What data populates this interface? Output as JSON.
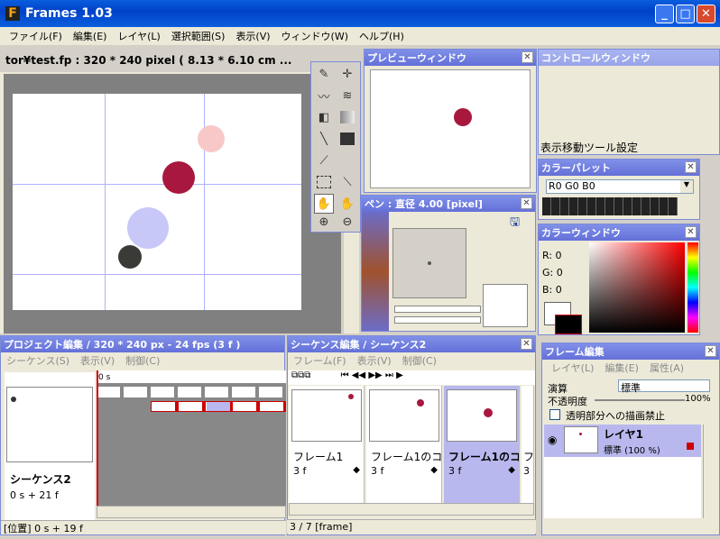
{
  "app": {
    "title": "Frames 1.03",
    "logo_letter": "F"
  },
  "window_buttons": {
    "min": "_",
    "max": "□",
    "close": "✕"
  },
  "menu": [
    "ファイル(F)",
    "編集(E)",
    "レイヤ(L)",
    "選択範囲(S)",
    "表示(V)",
    "ウィンドウ(W)",
    "ヘルプ(H)"
  ],
  "canvas": {
    "title": "tor¥test.fp : 320 * 240 pixel ( 8.13 * 6.10 cm ...",
    "bg_color": "#808080"
  },
  "preview": {
    "title": "プレビューウィンドウ",
    "close": "✕"
  },
  "control": {
    "title": "コントロールウィンドウ",
    "status": "表示移動ツール設定"
  },
  "palette": {
    "title": "カラーパレット",
    "close": "✕",
    "value": "R0 G0 B0"
  },
  "color_window": {
    "title": "カラーウィンドウ",
    "close": "✕",
    "r": "R: 0",
    "g": "G: 0",
    "b": "B: 0"
  },
  "pen": {
    "title": "ペン : 直径 4.00 [pixel]",
    "close": "✕"
  },
  "project": {
    "title": "プロジェクト編集 / 320 * 240 px - 24 fps (3 f )",
    "menu": [
      "シーケンス(S)",
      "表示(V)",
      "制御(C)"
    ],
    "seq_name": "シーケンス2",
    "seq_time": "0 s + 21 f",
    "timeline_mark": "0 s",
    "status": "[位置] 0 s + 19 f"
  },
  "sequence": {
    "title": "シーケンス編集 / シーケンス2",
    "close": "✕",
    "menu": [
      "フレーム(F)",
      "表示(V)",
      "制御(C)"
    ],
    "playback": "⏮ ◀◀ ▶▶ ⏭ ▶",
    "frames": [
      {
        "name": "フレーム1",
        "duration": "3 f"
      },
      {
        "name": "フレーム1のコピ",
        "duration": "3 f"
      },
      {
        "name": "フレーム1のコ",
        "duration": "3 f"
      },
      {
        "name": "フ",
        "duration": "3"
      }
    ],
    "status": "3 / 7 [frame]"
  },
  "frame_edit": {
    "title": "フレーム編集",
    "close": "✕",
    "menu": [
      "レイヤ(L)",
      "編集(E)",
      "属性(A)"
    ],
    "blend_label": "演算",
    "blend_value": "標準",
    "opacity_label": "不透明度",
    "opacity_value": "100%",
    "checkbox_label": "透明部分への描画禁止",
    "layer_name": "レイヤ1",
    "layer_mode": "標準 (100 %)"
  }
}
